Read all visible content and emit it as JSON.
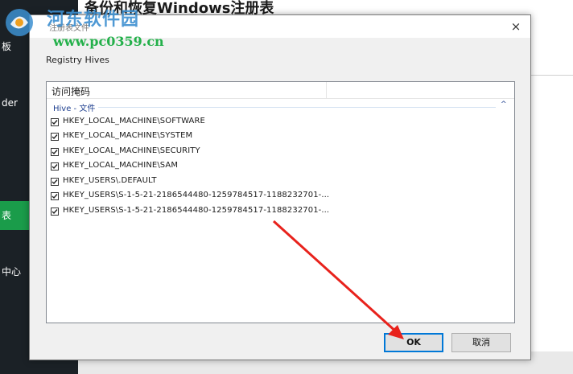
{
  "app": {
    "title": "备份和恢复Windows注册表",
    "sidebar_items": [
      "板",
      "der",
      "中心"
    ],
    "sidebar_active": "表"
  },
  "watermark": {
    "site_name": "河东软件园",
    "url": "www.pc0359.cn"
  },
  "dialog": {
    "title": "注册表文件",
    "section_label": "Registry Hives",
    "column_header": "访问掩码",
    "group_label": "Hive - 文件",
    "group_collapse": "^",
    "hives": [
      {
        "label": "HKEY_LOCAL_MACHINE\\SOFTWARE",
        "checked": true
      },
      {
        "label": "HKEY_LOCAL_MACHINE\\SYSTEM",
        "checked": true
      },
      {
        "label": "HKEY_LOCAL_MACHINE\\SECURITY",
        "checked": true
      },
      {
        "label": "HKEY_LOCAL_MACHINE\\SAM",
        "checked": true
      },
      {
        "label": "HKEY_USERS\\.DEFAULT",
        "checked": true
      },
      {
        "label": "HKEY_USERS\\S-1-5-21-2186544480-1259784517-1188232701-...",
        "checked": true
      },
      {
        "label": "HKEY_USERS\\S-1-5-21-2186544480-1259784517-1188232701-...",
        "checked": true
      }
    ],
    "ok_label": "OK",
    "cancel_label": "取消",
    "close_icon": "×"
  },
  "colors": {
    "sidebar_bg": "#1b2126",
    "sidebar_active": "#1a9c4a",
    "group_text": "#1e3f8f",
    "ok_border": "#0078d7",
    "annotation": "#e8221c"
  }
}
